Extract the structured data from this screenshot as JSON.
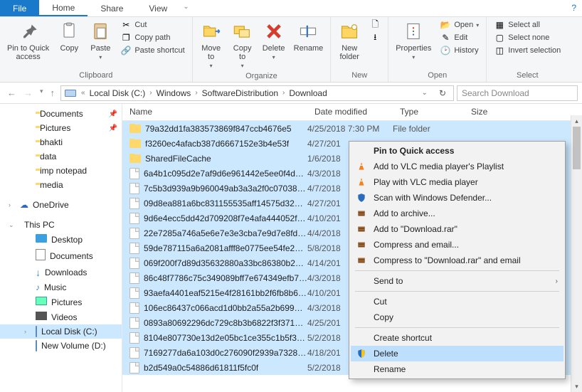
{
  "tabs": {
    "file": "File",
    "home": "Home",
    "share": "Share",
    "view": "View"
  },
  "ribbon": {
    "clipboard": {
      "label": "Clipboard",
      "pin": "Pin to Quick\naccess",
      "copy": "Copy",
      "paste": "Paste",
      "cut": "Cut",
      "copypath": "Copy path",
      "pasteshortcut": "Paste shortcut"
    },
    "organize": {
      "label": "Organize",
      "moveto": "Move\nto",
      "copyto": "Copy\nto",
      "delete": "Delete",
      "rename": "Rename"
    },
    "new": {
      "label": "New",
      "newfolder": "New\nfolder"
    },
    "open": {
      "label": "Open",
      "properties": "Properties",
      "open": "Open",
      "edit": "Edit",
      "history": "History"
    },
    "select": {
      "label": "Select",
      "all": "Select all",
      "none": "Select none",
      "invert": "Invert selection"
    }
  },
  "breadcrumb": {
    "parts": [
      "Local Disk (C:)",
      "Windows",
      "SoftwareDistribution",
      "Download"
    ]
  },
  "search": {
    "placeholder": "Search Download"
  },
  "columns": {
    "name": "Name",
    "date": "Date modified",
    "type": "Type",
    "size": "Size"
  },
  "sidebar": {
    "quick": [
      {
        "label": "Documents",
        "pin": true
      },
      {
        "label": "Pictures",
        "pin": true
      },
      {
        "label": "bhakti"
      },
      {
        "label": "data"
      },
      {
        "label": "imp notepad"
      },
      {
        "label": "media"
      }
    ],
    "onedrive": "OneDrive",
    "thispc": "This PC",
    "pcitems": [
      {
        "label": "Desktop",
        "icon": "desktop"
      },
      {
        "label": "Documents",
        "icon": "docs"
      },
      {
        "label": "Downloads",
        "icon": "down"
      },
      {
        "label": "Music",
        "icon": "music"
      },
      {
        "label": "Pictures",
        "icon": "pics"
      },
      {
        "label": "Videos",
        "icon": "video"
      },
      {
        "label": "Local Disk (C:)",
        "icon": "drive",
        "sel": true
      },
      {
        "label": "New Volume (D:)",
        "icon": "drive"
      }
    ]
  },
  "files": [
    {
      "name": "79a32dd1fa383573869f847ccb4676e5",
      "date": "4/25/2018 7:30 PM",
      "type": "File folder",
      "icon": "folder"
    },
    {
      "name": "f3260ec4afacb387d6667152e3b4e53f",
      "date": "4/27/201",
      "type": "",
      "icon": "folder"
    },
    {
      "name": "SharedFileCache",
      "date": "1/6/2018",
      "type": "",
      "icon": "folder"
    },
    {
      "name": "6a4b1c095d2e7af9d6e961442e5ee0f4d1eb...",
      "date": "4/3/2018",
      "type": "",
      "icon": "file"
    },
    {
      "name": "7c5b3d939a9b960049ab3a3a2f0c07038ad...",
      "date": "4/7/2018",
      "type": "",
      "icon": "file"
    },
    {
      "name": "09d8ea881a6bc831155535aff14575d3203e...",
      "date": "4/27/201",
      "type": "",
      "icon": "file"
    },
    {
      "name": "9d6e4ecc5dd42d709208f7e4afa444052fb9...",
      "date": "4/10/201",
      "type": "",
      "icon": "file"
    },
    {
      "name": "22e7285a746a5e6e7e3e3cba7e9d7e8fd8e8...",
      "date": "4/4/2018",
      "type": "",
      "icon": "file"
    },
    {
      "name": "59de787115a6a2081afff8e0775ee54fe2765...",
      "date": "5/8/2018",
      "type": "",
      "icon": "file"
    },
    {
      "name": "069f200f7d89d35632880a33bc86380b256...",
      "date": "4/14/201",
      "type": "",
      "icon": "file"
    },
    {
      "name": "86c48f7786c75c349089bff7e674349efb725...",
      "date": "4/3/2018",
      "type": "",
      "icon": "file"
    },
    {
      "name": "93aefa4401eaf5215e4f28161bb2f6fb8b652...",
      "date": "4/10/201",
      "type": "",
      "icon": "file"
    },
    {
      "name": "106ec86437c066acd1d0bb2a55a2b699dee...",
      "date": "4/3/2018",
      "type": "",
      "icon": "file"
    },
    {
      "name": "0893a80692296dc729c8b3b6822f3f3714f1...",
      "date": "4/25/201",
      "type": "",
      "icon": "file"
    },
    {
      "name": "8104e807730e13d2e05bc1ce355c1b5f396e...",
      "date": "5/2/2018",
      "type": "",
      "icon": "file"
    },
    {
      "name": "7169277da6a103d0c276090f2939a73285fd...",
      "date": "4/18/201",
      "type": "",
      "icon": "file"
    },
    {
      "name": "b2d549a0c54886d61811f5fc0f                    ",
      "date": "5/2/2018",
      "type": "",
      "icon": "file"
    }
  ],
  "context": {
    "pin": "Pin to Quick access",
    "vlc_playlist": "Add to VLC media player's Playlist",
    "vlc_play": "Play with VLC media player",
    "defender": "Scan with Windows Defender...",
    "add_archive": "Add to archive...",
    "add_rar": "Add to \"Download.rar\"",
    "compress_email": "Compress and email...",
    "compress_rar_email": "Compress to \"Download.rar\" and email",
    "sendto": "Send to",
    "cut": "Cut",
    "copy": "Copy",
    "shortcut": "Create shortcut",
    "delete": "Delete",
    "rename": "Rename"
  }
}
